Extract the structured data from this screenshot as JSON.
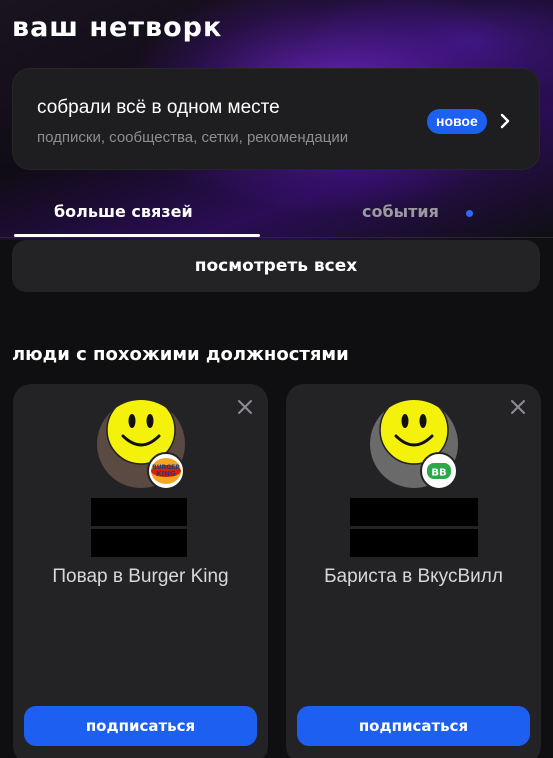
{
  "header": {
    "title": "ваш нетворк"
  },
  "promo": {
    "title": "собрали всё в одном месте",
    "subtitle": "подписки, сообщества, сетки, рекомендации",
    "badge": "новое"
  },
  "tabs": [
    {
      "label": "больше связей",
      "active": true
    },
    {
      "label": "события",
      "active": false,
      "has_dot": true
    }
  ],
  "see_all": {
    "label": "посмотреть всех"
  },
  "section": {
    "heading": "люди с похожими должностями"
  },
  "people": [
    {
      "role": "Повар в Burger King",
      "logo": "burger-king-logo",
      "subscribe_label": "подписаться"
    },
    {
      "role": "Бариста в ВкусВилл",
      "logo": "vkusvill-logo",
      "logo_text": "BB",
      "subscribe_label": "подписаться"
    }
  ],
  "colors": {
    "accent": "#1d5ff0",
    "background": "#0f0f11",
    "card": "#232326"
  }
}
